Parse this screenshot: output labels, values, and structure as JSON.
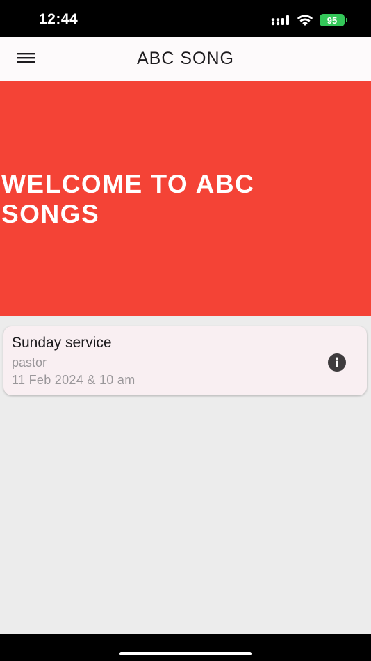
{
  "status_bar": {
    "time": "12:44",
    "battery_level": "95"
  },
  "icons": {
    "menu": "hamburger-menu-icon",
    "info": "info-icon",
    "signal": "cellular-signal-icon",
    "wifi": "wifi-icon",
    "battery": "battery-charging-icon"
  },
  "app_bar": {
    "title": "ABC SONG"
  },
  "hero": {
    "title": "WELCOME TO ABC SONGS"
  },
  "events": [
    {
      "title": "Sunday service",
      "subtitle": "pastor",
      "datetime": "11 Feb 2024 & 10 am"
    }
  ],
  "colors": {
    "hero_background": "#f44336",
    "app_bar_background": "#fdfafb",
    "card_background": "#f9eff2",
    "screen_background": "#ececec",
    "battery": "#34c759"
  }
}
